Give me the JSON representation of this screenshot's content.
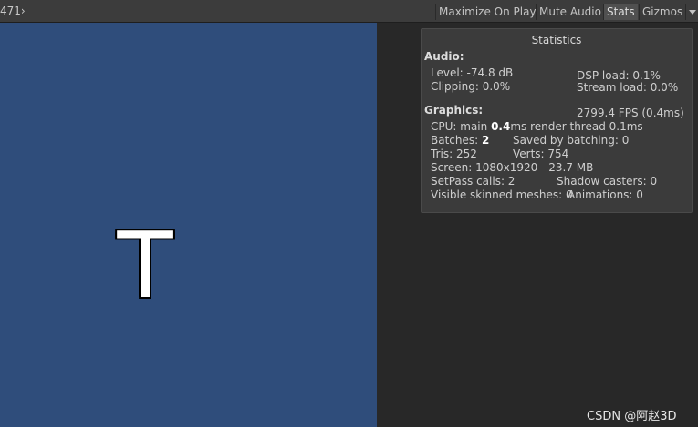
{
  "toolbar": {
    "resolution_label": "471›",
    "maximize_label": "Maximize On Play",
    "mute_label": "Mute Audio",
    "stats_label": "Stats",
    "gizmos_label": "Gizmos"
  },
  "game_view": {
    "text": "T",
    "background_color": "#2f4d7b"
  },
  "stats": {
    "title": "Statistics",
    "audio_header": "Audio:",
    "level": "Level: -74.8 dB",
    "dsp_load": "DSP load: 0.1%",
    "clipping": "Clipping: 0.0%",
    "stream_load": "Stream load: 0.0%",
    "graphics_header": "Graphics:",
    "fps": "2799.4 FPS (0.4ms)",
    "cpu_prefix": "CPU: main ",
    "cpu_main": "0.4",
    "cpu_suffix": "ms  render thread 0.1ms",
    "batches_prefix": "Batches: ",
    "batches": "2",
    "saved_by_batching": "Saved by batching: 0",
    "tris": "Tris: 252",
    "verts": "Verts: 754",
    "screen": "Screen: 1080x1920 - 23.7 MB",
    "setpass": "SetPass calls: 2",
    "shadow_casters": "Shadow casters: 0",
    "skinned_meshes": "Visible skinned meshes: 0",
    "animations": "Animations: 0"
  },
  "watermark": "CSDN @阿赵3D"
}
